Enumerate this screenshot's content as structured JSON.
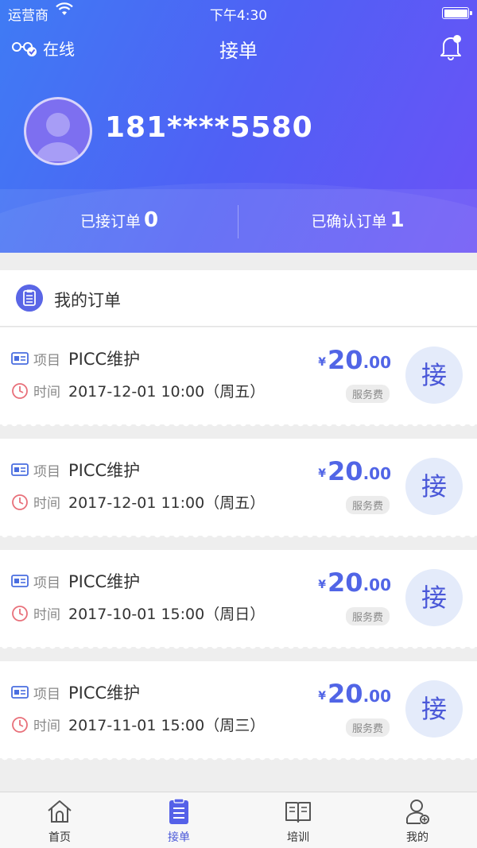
{
  "status_bar": {
    "carrier": "运营商",
    "time": "下午4:30"
  },
  "nav": {
    "online_label": "在线",
    "title": "接单"
  },
  "profile": {
    "phone": "181****5580"
  },
  "stats": {
    "accepted_label": "已接订单",
    "accepted_count": "0",
    "confirmed_label": "已确认订单",
    "confirmed_count": "1"
  },
  "section": {
    "title": "我的订单"
  },
  "orders": [
    {
      "project_label": "项目",
      "project": "PICC维护",
      "time_label": "时间",
      "time": "2017-12-01 10:00（周五）",
      "currency": "¥",
      "price_int": "20",
      "price_dec": ".00",
      "fee_label": "服务费",
      "accept_label": "接"
    },
    {
      "project_label": "项目",
      "project": "PICC维护",
      "time_label": "时间",
      "time": "2017-12-01 11:00（周五）",
      "currency": "¥",
      "price_int": "20",
      "price_dec": ".00",
      "fee_label": "服务费",
      "accept_label": "接"
    },
    {
      "project_label": "项目",
      "project": "PICC维护",
      "time_label": "时间",
      "time": "2017-10-01 15:00（周日）",
      "currency": "¥",
      "price_int": "20",
      "price_dec": ".00",
      "fee_label": "服务费",
      "accept_label": "接"
    },
    {
      "project_label": "项目",
      "project": "PICC维护",
      "time_label": "时间",
      "time": "2017-11-01 15:00（周三）",
      "currency": "¥",
      "price_int": "20",
      "price_dec": ".00",
      "fee_label": "服务费",
      "accept_label": "接"
    }
  ],
  "tabbar": {
    "items": [
      {
        "label": "首页",
        "icon": "home-icon"
      },
      {
        "label": "接单",
        "icon": "clipboard-icon"
      },
      {
        "label": "培训",
        "icon": "book-icon"
      },
      {
        "label": "我的",
        "icon": "user-icon"
      }
    ],
    "active_index": 1
  },
  "colors": {
    "accent": "#4a58d8",
    "header_start": "#3f7bf4",
    "header_end": "#6b52f6"
  }
}
